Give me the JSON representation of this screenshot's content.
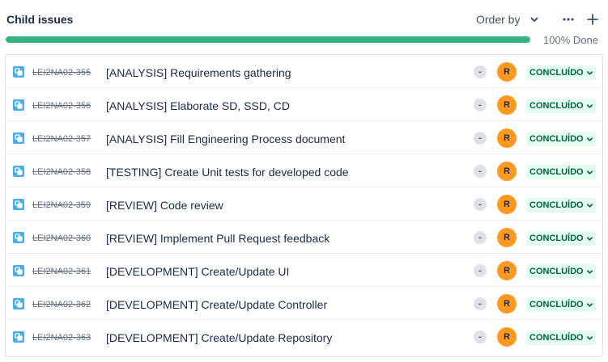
{
  "header": {
    "title": "Child issues",
    "order_by_label": "Order by"
  },
  "progress": {
    "percent_done": 100,
    "label": "100% Done",
    "fill_color": "#36b37e"
  },
  "issues": [
    {
      "key": "LEI2NA02-355",
      "summary": "[ANALYSIS] Requirements gathering",
      "priority": "-",
      "assignee_initial": "R",
      "status": "CONCLUÍDO"
    },
    {
      "key": "LEI2NA02-356",
      "summary": "[ANALYSIS] Elaborate SD, SSD, CD",
      "priority": "-",
      "assignee_initial": "R",
      "status": "CONCLUÍDO"
    },
    {
      "key": "LEI2NA02-357",
      "summary": "[ANALYSIS] Fill Engineering Process document",
      "priority": "-",
      "assignee_initial": "R",
      "status": "CONCLUÍDO"
    },
    {
      "key": "LEI2NA02-358",
      "summary": "[TESTING] Create Unit tests for developed code",
      "priority": "-",
      "assignee_initial": "R",
      "status": "CONCLUÍDO"
    },
    {
      "key": "LEI2NA02-359",
      "summary": "[REVIEW] Code review",
      "priority": "-",
      "assignee_initial": "R",
      "status": "CONCLUÍDO"
    },
    {
      "key": "LEI2NA02-360",
      "summary": "[REVIEW] Implement Pull Request feedback",
      "priority": "-",
      "assignee_initial": "R",
      "status": "CONCLUÍDO"
    },
    {
      "key": "LEI2NA02-361",
      "summary": "[DEVELOPMENT] Create/Update UI",
      "priority": "-",
      "assignee_initial": "R",
      "status": "CONCLUÍDO"
    },
    {
      "key": "LEI2NA02-362",
      "summary": "[DEVELOPMENT] Create/Update Controller",
      "priority": "-",
      "assignee_initial": "R",
      "status": "CONCLUÍDO"
    },
    {
      "key": "LEI2NA02-363",
      "summary": "[DEVELOPMENT] Create/Update Repository",
      "priority": "-",
      "assignee_initial": "R",
      "status": "CONCLUÍDO"
    }
  ],
  "icons": {
    "issue_type": "subtask-icon",
    "order_by": "chevron-down-icon",
    "more": "more-horizontal-icon",
    "add": "plus-icon",
    "status_dropdown": "chevron-down-icon"
  },
  "colors": {
    "subtask_icon": "#4bade8",
    "avatar": "#ff991f",
    "status_bg": "#e3fcef",
    "status_text": "#006644"
  }
}
